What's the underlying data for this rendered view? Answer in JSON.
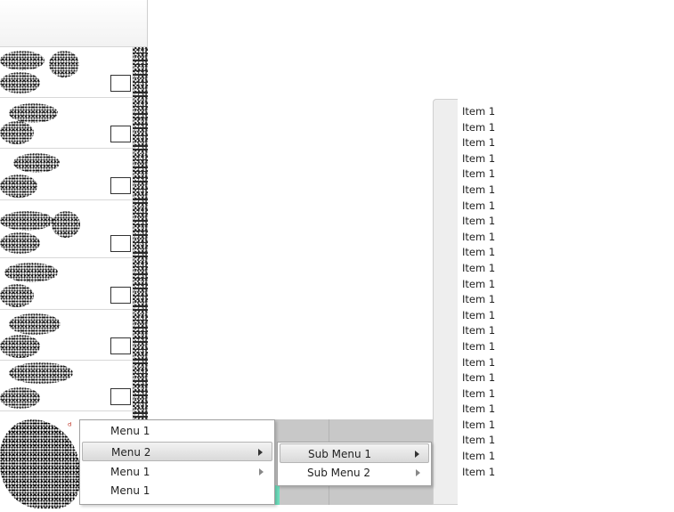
{
  "context_menu": {
    "items": [
      {
        "label": "Menu 1",
        "has_submenu": false
      },
      {
        "label": "Menu 2",
        "has_submenu": true,
        "highlighted": true
      },
      {
        "label": "Menu 1",
        "has_submenu": true
      },
      {
        "label": "Menu 1",
        "has_submenu": false
      }
    ]
  },
  "submenu": {
    "items": [
      {
        "label": "Sub Menu 1",
        "highlighted": true
      },
      {
        "label": "Sub Menu 2"
      }
    ]
  },
  "item_list": {
    "items": [
      "Item 1",
      "Item 1",
      "Item 1",
      "Item 1",
      "Item 1",
      "Item 1",
      "Item 1",
      "Item 1",
      "Item 1",
      "Item 1",
      "Item 1",
      "Item 1",
      "Item 1",
      "Item 1",
      "Item 1",
      "Item 1",
      "Item 1",
      "Item 1",
      "Item 1",
      "Item 1",
      "Item 1",
      "Item 1",
      "Item 1",
      "Item 1"
    ]
  },
  "colors": {
    "highlight_start": "#f3f3f3",
    "highlight_end": "#d9d9d9",
    "teal_strip": "#6fe0bf",
    "gray_strip": "#c8c8c8"
  }
}
